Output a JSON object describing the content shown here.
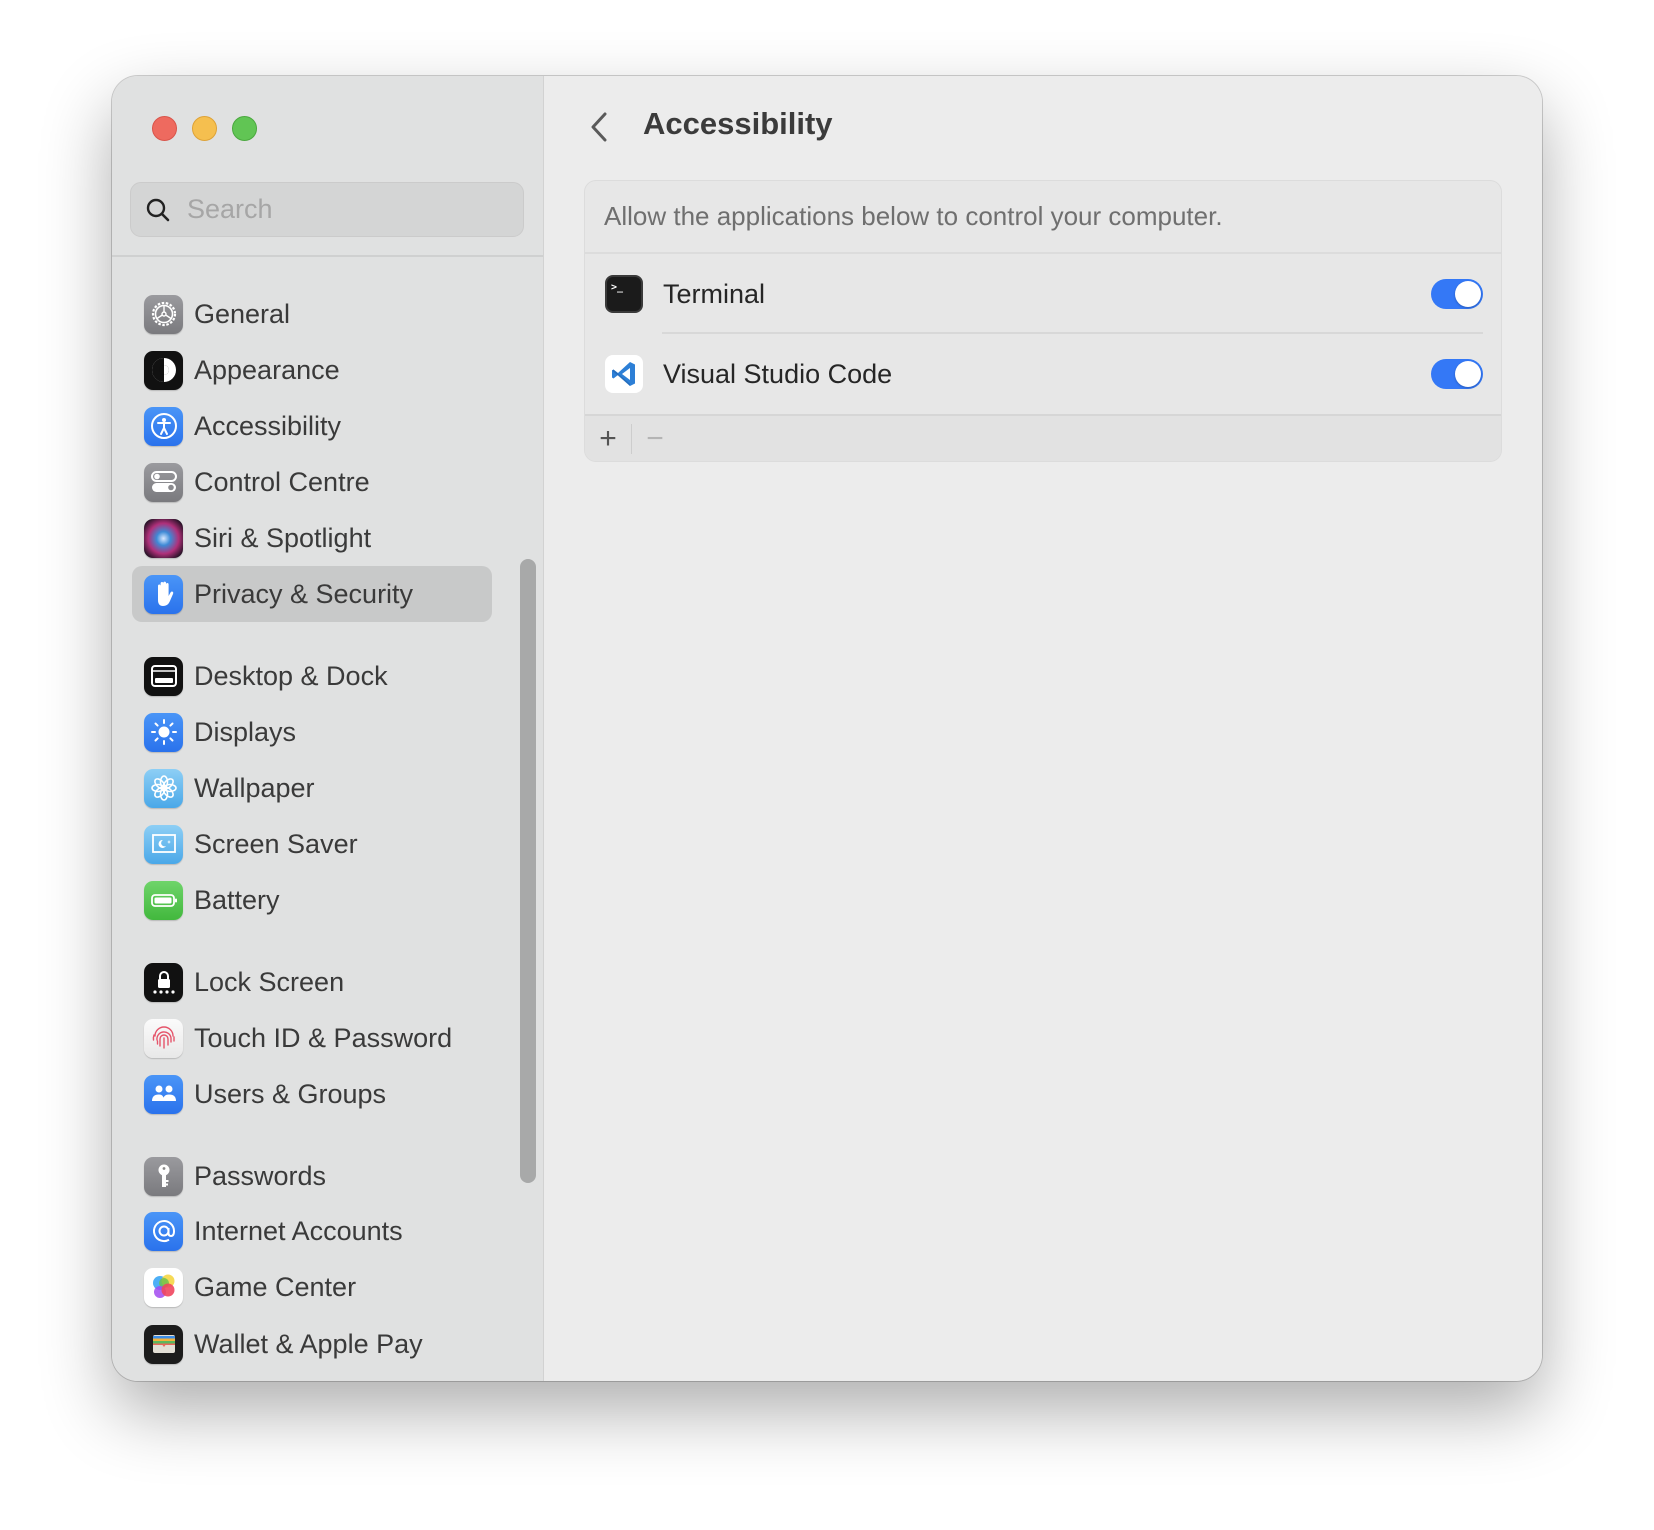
{
  "window": {
    "traffic_lights": [
      "close",
      "minimize",
      "zoom"
    ]
  },
  "sidebar": {
    "search": {
      "placeholder": "Search",
      "value": ""
    },
    "selected": "Privacy & Security",
    "items": [
      {
        "label": "General",
        "icon": "gear-icon",
        "group": 1
      },
      {
        "label": "Appearance",
        "icon": "appearance-icon",
        "group": 1
      },
      {
        "label": "Accessibility",
        "icon": "accessibility-icon",
        "group": 1
      },
      {
        "label": "Control Centre",
        "icon": "control-centre-icon",
        "group": 1
      },
      {
        "label": "Siri & Spotlight",
        "icon": "siri-icon",
        "group": 1
      },
      {
        "label": "Privacy & Security",
        "icon": "hand-icon",
        "group": 1
      },
      {
        "label": "Desktop & Dock",
        "icon": "dock-icon",
        "group": 2
      },
      {
        "label": "Displays",
        "icon": "sun-icon",
        "group": 2
      },
      {
        "label": "Wallpaper",
        "icon": "flower-icon",
        "group": 2
      },
      {
        "label": "Screen Saver",
        "icon": "screensaver-icon",
        "group": 2
      },
      {
        "label": "Battery",
        "icon": "battery-icon",
        "group": 2
      },
      {
        "label": "Lock Screen",
        "icon": "lock-icon",
        "group": 3
      },
      {
        "label": "Touch ID & Password",
        "icon": "fingerprint-icon",
        "group": 3
      },
      {
        "label": "Users & Groups",
        "icon": "users-icon",
        "group": 3
      },
      {
        "label": "Passwords",
        "icon": "key-icon",
        "group": 4
      },
      {
        "label": "Internet Accounts",
        "icon": "at-icon",
        "group": 4
      },
      {
        "label": "Game Center",
        "icon": "game-center-icon",
        "group": 4
      },
      {
        "label": "Wallet & Apple Pay",
        "icon": "wallet-icon",
        "group": 4
      }
    ]
  },
  "main": {
    "title": "Accessibility",
    "back_icon": "chevron-left-icon",
    "description": "Allow the applications below to control your computer.",
    "apps": [
      {
        "name": "Terminal",
        "icon": "terminal-icon",
        "enabled": true
      },
      {
        "name": "Visual Studio Code",
        "icon": "vscode-icon",
        "enabled": true
      }
    ],
    "footer": {
      "add_label": "+",
      "remove_label": "−"
    },
    "colors": {
      "toggle_on": "#3478f6"
    }
  }
}
